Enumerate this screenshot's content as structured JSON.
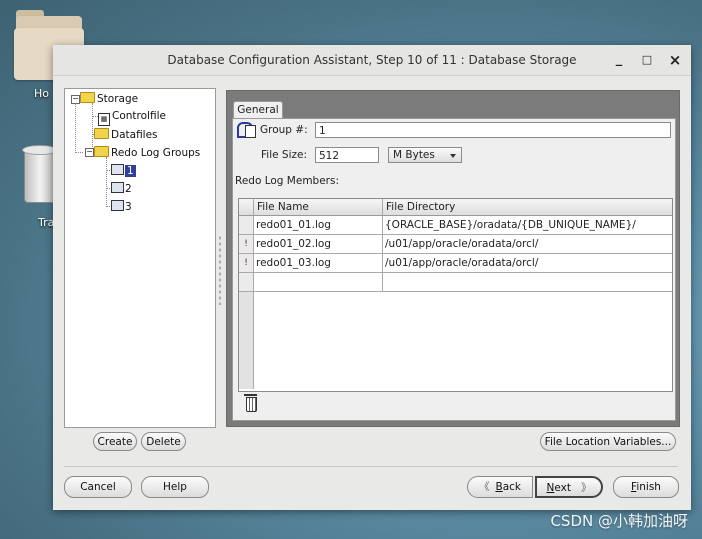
{
  "desktop": {
    "home_label": "Ho",
    "trash_label": "Tra",
    "watermark": "CSDN @小韩加油呀"
  },
  "window": {
    "title": "Database Configuration Assistant, Step 10 of 11 : Database Storage",
    "minimize": "_",
    "maximize": "□",
    "close": "×"
  },
  "tree": {
    "root": "Storage",
    "controlfile": "Controlfile",
    "datafiles": "Datafiles",
    "redo_groups": "Redo Log Groups",
    "groups": [
      "1",
      "2",
      "3"
    ],
    "selected_group": "1"
  },
  "tree_buttons": {
    "create": "Create",
    "delete": "Delete"
  },
  "tab": {
    "general": "General"
  },
  "form": {
    "group_label": "Group #:",
    "group_value": "1",
    "filesize_label": "File Size:",
    "filesize_value": "512",
    "unit_value": "M Bytes",
    "members_label": "Redo Log Members:"
  },
  "members_table": {
    "headers": [
      "File Name",
      "File Directory"
    ],
    "rows": [
      {
        "name": "redo01_01.log",
        "dir": "{ORACLE_BASE}/oradata/{DB_UNIQUE_NAME}/",
        "marker": ""
      },
      {
        "name": "redo01_02.log",
        "dir": "/u01/app/oracle/oradata/orcl/",
        "marker": "!"
      },
      {
        "name": "redo01_03.log",
        "dir": "/u01/app/oracle/oradata/orcl/",
        "marker": "!"
      },
      {
        "name": "",
        "dir": "",
        "marker": ""
      }
    ]
  },
  "buttons": {
    "file_location": "File Location Variables...",
    "cancel": "Cancel",
    "help": "Help",
    "back_prefix": "",
    "back_u": "B",
    "back_rest": "ack",
    "next_prefix": "",
    "next_u": "N",
    "next_rest": "ext",
    "finish_u": "F",
    "finish_rest": "inish"
  }
}
